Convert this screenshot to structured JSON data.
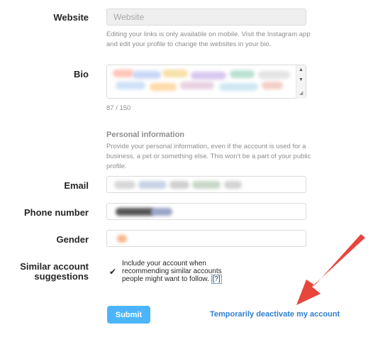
{
  "website": {
    "label": "Website",
    "placeholder": "Website",
    "help": "Editing your links is only available on mobile. Visit the Instagram app and edit your profile to change the websites in your bio."
  },
  "bio": {
    "label": "Bio",
    "counter": "87 / 150"
  },
  "personal_info": {
    "title": "Personal information",
    "description": "Provide your personal information, even if the account is used for a business, a pet or something else. This won't be a part of your public profile."
  },
  "email": {
    "label": "Email"
  },
  "phone": {
    "label": "Phone number"
  },
  "gender": {
    "label": "Gender"
  },
  "similar": {
    "label_line1": "Similar account",
    "label_line2": "suggestions",
    "checkbox_text": "Include your account when recommending similar accounts people might want to follow.",
    "help_link": "[?]",
    "checked": true
  },
  "actions": {
    "submit": "Submit",
    "deactivate": "Temporarily deactivate my account"
  },
  "colors": {
    "submit_bg": "#4cb5f9",
    "link": "#2f7fd0",
    "annotation_arrow": "#e8453c"
  }
}
